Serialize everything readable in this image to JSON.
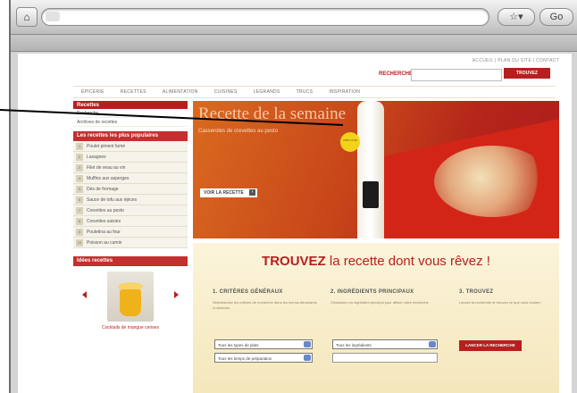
{
  "browser": {
    "home_glyph": "⌂",
    "star_label": "☆▾",
    "search_label": "Go"
  },
  "header": {
    "account_links": "ACCUEIL | PLAN DU SITE | CONTACT",
    "search_label": "RECHERCHER",
    "search_placeholder": "",
    "search_button": "TROUVEZ"
  },
  "nav": {
    "items": [
      "ÉPICERIE",
      "RECETTES",
      "ALIMENTATION",
      "CUISINES",
      "LEGRANDS",
      "TRUCS",
      "INSPIRATION"
    ]
  },
  "sidebar": {
    "section1_title": "Recettes",
    "section1_links": [
      "Recherche",
      "Archives de recettes"
    ],
    "section2_title": "Les recettes les plus populaires",
    "popular": [
      {
        "num": "1",
        "label": "Poulet piment fumé"
      },
      {
        "num": "2",
        "label": "Lasagnes"
      },
      {
        "num": "3",
        "label": "Filet de veau au vin"
      },
      {
        "num": "4",
        "label": "Muffins aux asperges"
      },
      {
        "num": "5",
        "label": "Dés de fromage"
      },
      {
        "num": "6",
        "label": "Sauce de tofu aux épices"
      },
      {
        "num": "7",
        "label": "Crevettes au pesto"
      },
      {
        "num": "8",
        "label": "Crevettes saisies"
      },
      {
        "num": "9",
        "label": "Pouletina au four"
      },
      {
        "num": "10",
        "label": "Poisson au cumin"
      }
    ],
    "section3_title": "Idées recettes",
    "carousel_caption": "Cocktails de mangue cerises"
  },
  "hero": {
    "title": "Recette de la semaine",
    "subtitle": "Casseroles de crevettes au pesto",
    "button_label": "VOIR LA RECETTE",
    "button_arrow": "›",
    "badge_text": "PRIX 17.99"
  },
  "finder": {
    "title_bold": "TROUVEZ",
    "title_rest": " la recette dont vous rêvez !",
    "col1_title": "1. CRITÈRES GÉNÉRAUX",
    "col1_text": "Sélectionnez les critères de recherche dans les menus déroulants ci-dessous.",
    "col2_title": "2. INGRÉDIENTS PRINCIPAUX",
    "col2_text": "Choisissez un ingrédient principal pour affiner votre recherche.",
    "col3_title": "3. TROUVEZ",
    "col3_text": "Lancez la recherche et trouvez ce que vous voulez !",
    "select_type": "Tous les types de plats",
    "select_time": "Tous les temps de préparation",
    "select_ingredient": "Tous les ingrédients",
    "ingredient_placeholder": "",
    "go_button": "LANCER LA RECHERCHE"
  }
}
